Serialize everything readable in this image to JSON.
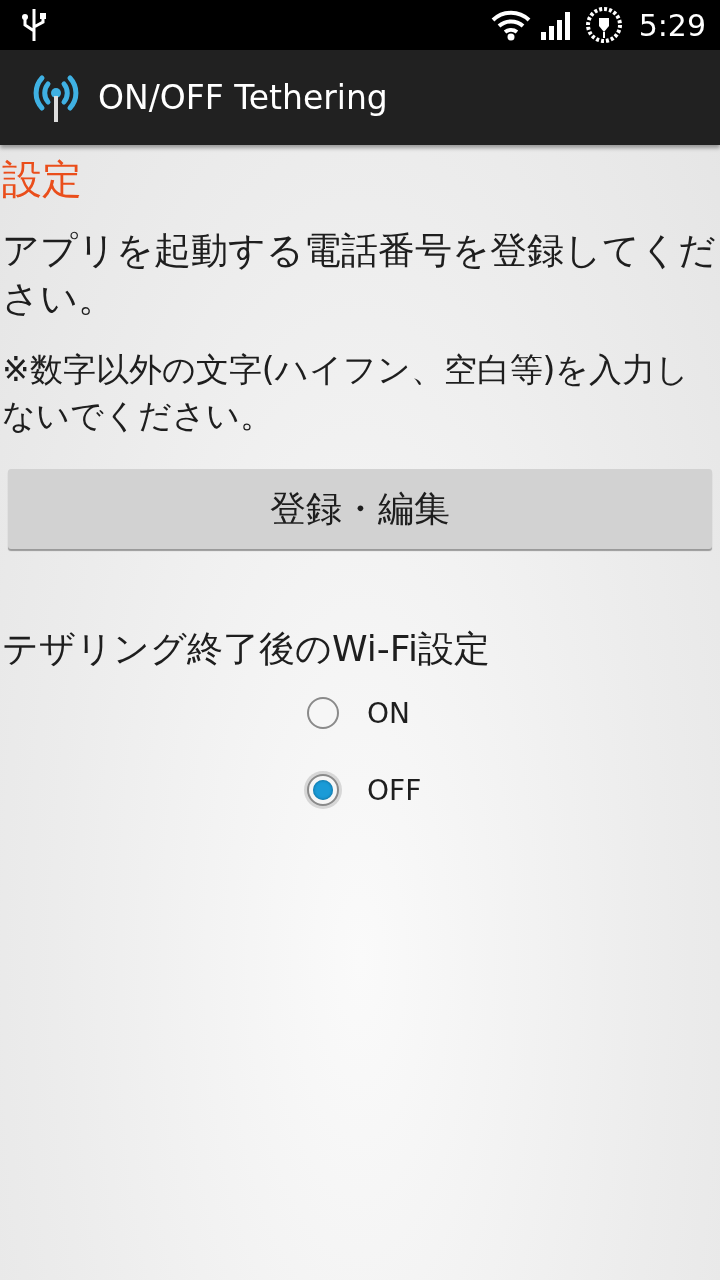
{
  "status_bar": {
    "time": "5:29"
  },
  "action_bar": {
    "title": "ON/OFF Tethering"
  },
  "section_title": "設定",
  "instruction": "アプリを起動する電話番号を登録してください。",
  "note": "※数字以外の文字(ハイフン、空白等)を入力しないでください。",
  "register_button": "登録・編集",
  "wifi_setting": {
    "label": "テザリング終了後のWi-Fi設定",
    "options": [
      {
        "label": "ON",
        "selected": false
      },
      {
        "label": "OFF",
        "selected": true
      }
    ]
  }
}
